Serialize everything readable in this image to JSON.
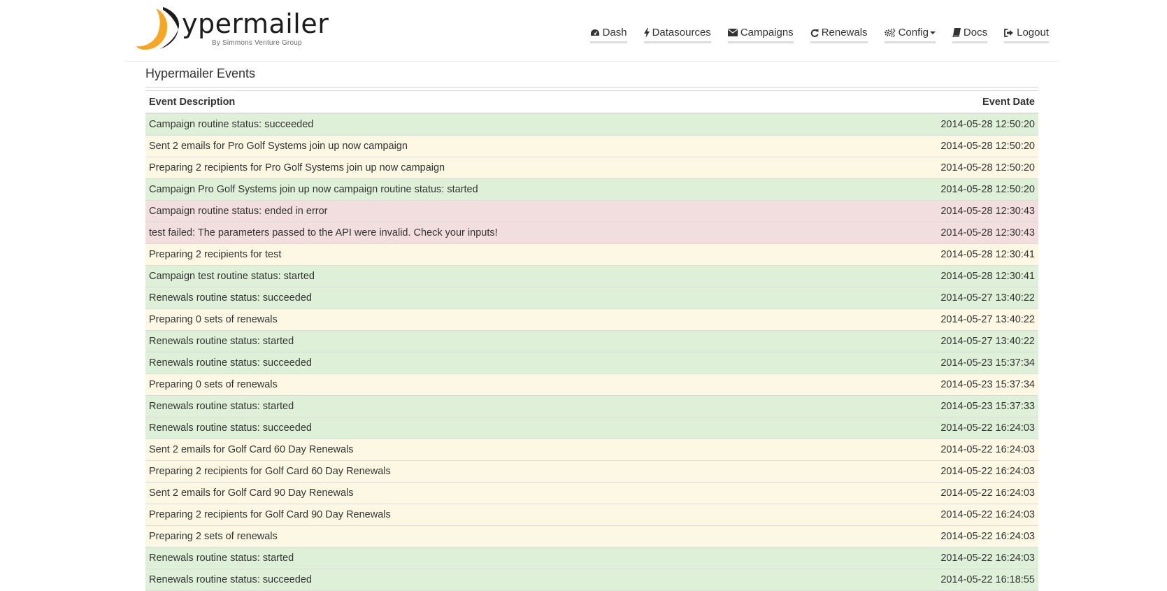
{
  "brand": {
    "wordmark": "ypermailer",
    "tagline": "By Simmons Venture Group",
    "accent": "#f5a623"
  },
  "nav": [
    {
      "label": "Dash",
      "icon": "dashboard-icon"
    },
    {
      "label": "Datasources",
      "icon": "bolt-icon"
    },
    {
      "label": "Campaigns",
      "icon": "envelope-icon"
    },
    {
      "label": "Renewals",
      "icon": "refresh-icon"
    },
    {
      "label": "Config",
      "icon": "cogs-icon",
      "dropdown": true
    },
    {
      "label": "Docs",
      "icon": "book-icon"
    },
    {
      "label": "Logout",
      "icon": "sign-out-icon"
    }
  ],
  "page": {
    "title": "Hypermailer Events"
  },
  "table": {
    "headers": {
      "description": "Event Description",
      "date": "Event Date"
    },
    "rows": [
      {
        "description": "Campaign routine status: succeeded",
        "date": "2014-05-28 12:50:20",
        "status": "success"
      },
      {
        "description": "Sent 2 emails for Pro Golf Systems join up now campaign",
        "date": "2014-05-28 12:50:20",
        "status": "warning"
      },
      {
        "description": "Preparing 2 recipients for Pro Golf Systems join up now campaign",
        "date": "2014-05-28 12:50:20",
        "status": "warning"
      },
      {
        "description": "Campaign Pro Golf Systems join up now campaign routine status: started",
        "date": "2014-05-28 12:50:20",
        "status": "success"
      },
      {
        "description": "Campaign routine status: ended in error",
        "date": "2014-05-28 12:30:43",
        "status": "danger"
      },
      {
        "description": "test failed: The parameters passed to the API were invalid. Check your inputs!",
        "date": "2014-05-28 12:30:43",
        "status": "danger"
      },
      {
        "description": "Preparing 2 recipients for test",
        "date": "2014-05-28 12:30:41",
        "status": "warning"
      },
      {
        "description": "Campaign test routine status: started",
        "date": "2014-05-28 12:30:41",
        "status": "success"
      },
      {
        "description": "Renewals routine status: succeeded",
        "date": "2014-05-27 13:40:22",
        "status": "success"
      },
      {
        "description": "Preparing 0 sets of renewals",
        "date": "2014-05-27 13:40:22",
        "status": "warning"
      },
      {
        "description": "Renewals routine status: started",
        "date": "2014-05-27 13:40:22",
        "status": "success"
      },
      {
        "description": "Renewals routine status: succeeded",
        "date": "2014-05-23 15:37:34",
        "status": "success"
      },
      {
        "description": "Preparing 0 sets of renewals",
        "date": "2014-05-23 15:37:34",
        "status": "warning"
      },
      {
        "description": "Renewals routine status: started",
        "date": "2014-05-23 15:37:33",
        "status": "success"
      },
      {
        "description": "Renewals routine status: succeeded",
        "date": "2014-05-22 16:24:03",
        "status": "success"
      },
      {
        "description": "Sent 2 emails for Golf Card 60 Day Renewals",
        "date": "2014-05-22 16:24:03",
        "status": "warning"
      },
      {
        "description": "Preparing 2 recipients for Golf Card 60 Day Renewals",
        "date": "2014-05-22 16:24:03",
        "status": "warning"
      },
      {
        "description": "Sent 2 emails for Golf Card 90 Day Renewals",
        "date": "2014-05-22 16:24:03",
        "status": "warning"
      },
      {
        "description": "Preparing 2 recipients for Golf Card 90 Day Renewals",
        "date": "2014-05-22 16:24:03",
        "status": "warning"
      },
      {
        "description": "Preparing 2 sets of renewals",
        "date": "2014-05-22 16:24:03",
        "status": "warning"
      },
      {
        "description": "Renewals routine status: started",
        "date": "2014-05-22 16:24:03",
        "status": "success"
      },
      {
        "description": "Renewals routine status: succeeded",
        "date": "2014-05-22 16:18:55",
        "status": "success"
      }
    ]
  },
  "colors": {
    "success": "#dff0d8",
    "warning": "#fcf8e3",
    "danger": "#f2dede"
  }
}
